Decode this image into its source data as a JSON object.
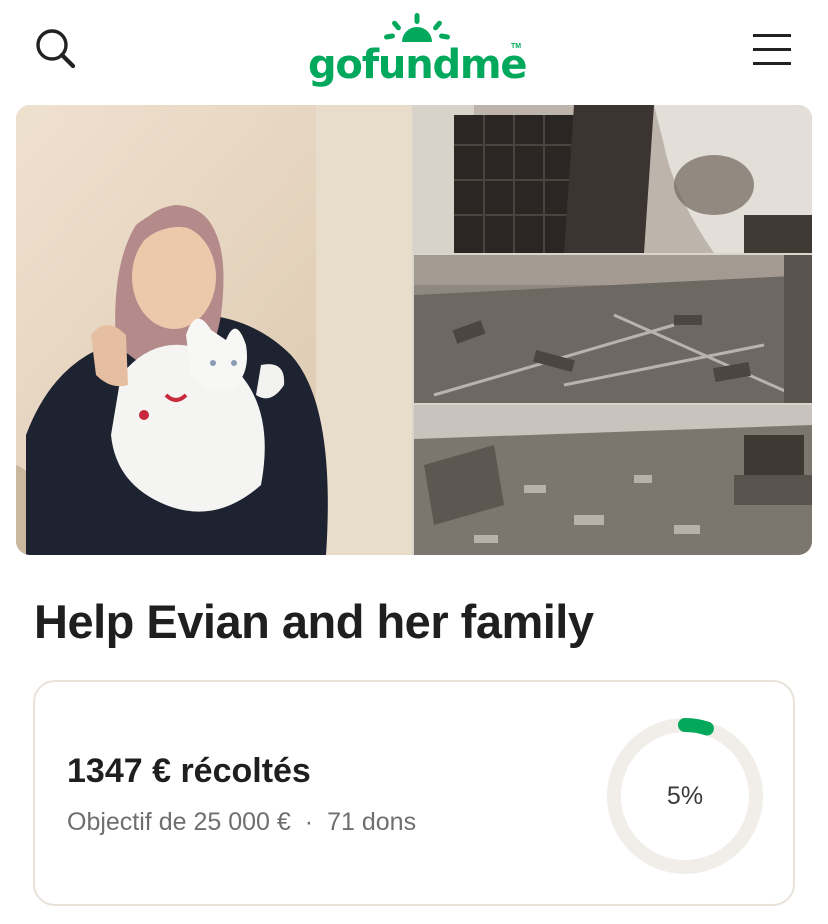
{
  "brand": {
    "logo_text": "gofundme",
    "trademark": "TM",
    "accent_color": "#02a95c"
  },
  "header": {
    "search_icon": "search-icon",
    "menu_icon": "hamburger-menu-icon"
  },
  "gallery": {
    "images": [
      {
        "name": "portrait-with-cat"
      },
      {
        "name": "burned-wall"
      },
      {
        "name": "burned-room-floor"
      },
      {
        "name": "burned-room-debris"
      }
    ]
  },
  "campaign": {
    "title": "Help Evian and her family",
    "raised_text": "1347 € récoltés",
    "goal_text": "Objectif de 25 000 €",
    "separator": "·",
    "donations_text": "71 dons",
    "progress_label": "5%",
    "progress_fraction": 0.05,
    "progress_color": "#02a95c",
    "track_color": "#f1eee9"
  }
}
